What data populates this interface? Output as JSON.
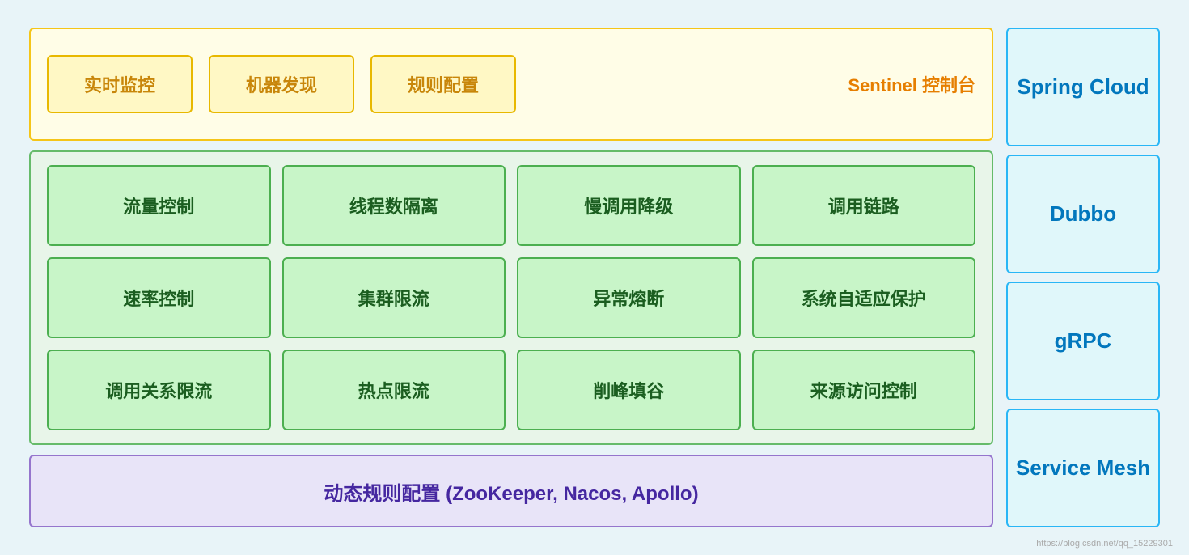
{
  "sentinel": {
    "box1": "实时监控",
    "box2": "机器发现",
    "box3": "规则配置",
    "label": "Sentinel 控制台"
  },
  "features": [
    "流量控制",
    "线程数隔离",
    "慢调用降级",
    "调用链路",
    "速率控制",
    "集群限流",
    "异常熔断",
    "系统自适应保护",
    "调用关系限流",
    "热点限流",
    "削峰填谷",
    "来源访问控制"
  ],
  "dynamic": {
    "text": "动态规则配置 (ZooKeeper, Nacos, Apollo)"
  },
  "right_panel": [
    "Spring Cloud",
    "Dubbo",
    "gRPC",
    "Service Mesh"
  ],
  "watermark": "https://blog.csdn.net/qq_15229301"
}
